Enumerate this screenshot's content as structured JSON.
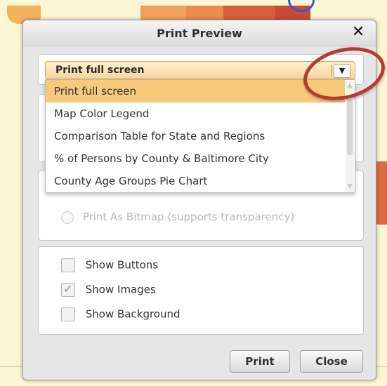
{
  "dialog": {
    "title": "Print Preview",
    "close_icon": "close-icon"
  },
  "print_select": {
    "value": "Print full screen",
    "options": [
      "Print full screen",
      "Map Color Legend",
      "Comparison Table for State and Regions",
      "% of Persons by County & Baltimore City",
      "County Age Groups Pie Chart"
    ]
  },
  "radio_options": {
    "bitmap_label": "Print As Bitmap (supports transparency)"
  },
  "checkboxes": [
    {
      "label": "Show Buttons",
      "checked": false
    },
    {
      "label": "Show Images",
      "checked": true
    },
    {
      "label": "Show Background",
      "checked": false
    }
  ],
  "buttons": {
    "print": "Print",
    "close": "Close"
  },
  "colors": {
    "accent": "#f8c97a",
    "highlight_circle": "#b93a32"
  }
}
